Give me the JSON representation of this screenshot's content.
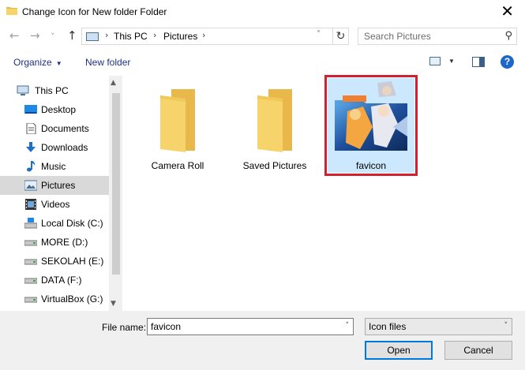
{
  "window": {
    "title": "Change Icon for New folder Folder",
    "close_glyph": "✕"
  },
  "nav": {
    "back_glyph": "←",
    "forward_glyph": "→",
    "recent_glyph": "˅",
    "up_glyph": "↑",
    "breadcrumb": [
      "This PC",
      "Pictures"
    ],
    "refresh_glyph": "↻",
    "search_placeholder": "Search Pictures"
  },
  "toolbar": {
    "organize_label": "Organize",
    "new_folder_label": "New folder",
    "help_glyph": "?"
  },
  "sidebar": {
    "items": [
      {
        "label": "This PC",
        "icon": "pc-icon"
      },
      {
        "label": "Desktop",
        "icon": "desktop-icon"
      },
      {
        "label": "Documents",
        "icon": "documents-icon"
      },
      {
        "label": "Downloads",
        "icon": "downloads-icon"
      },
      {
        "label": "Music",
        "icon": "music-icon"
      },
      {
        "label": "Pictures",
        "icon": "pictures-icon",
        "selected": true
      },
      {
        "label": "Videos",
        "icon": "videos-icon"
      },
      {
        "label": "Local Disk (C:)",
        "icon": "system-drive-icon"
      },
      {
        "label": "MORE (D:)",
        "icon": "drive-icon"
      },
      {
        "label": "SEKOLAH (E:)",
        "icon": "drive-icon"
      },
      {
        "label": "DATA (F:)",
        "icon": "drive-icon"
      },
      {
        "label": "VirtualBox (G:)",
        "icon": "drive-icon"
      }
    ]
  },
  "files": [
    {
      "name": "Camera Roll",
      "type": "folder"
    },
    {
      "name": "Saved Pictures",
      "type": "folder"
    },
    {
      "name": "favicon",
      "type": "icon-file",
      "selected": true
    }
  ],
  "footer": {
    "file_name_label": "File name:",
    "file_name_value": "favicon",
    "file_type_value": "Icon files",
    "open_label": "Open",
    "cancel_label": "Cancel"
  },
  "colors": {
    "accent": "#0078d7",
    "selection": "#cce8ff",
    "highlight_outline": "#d1212c",
    "link_text": "#1e3287"
  }
}
